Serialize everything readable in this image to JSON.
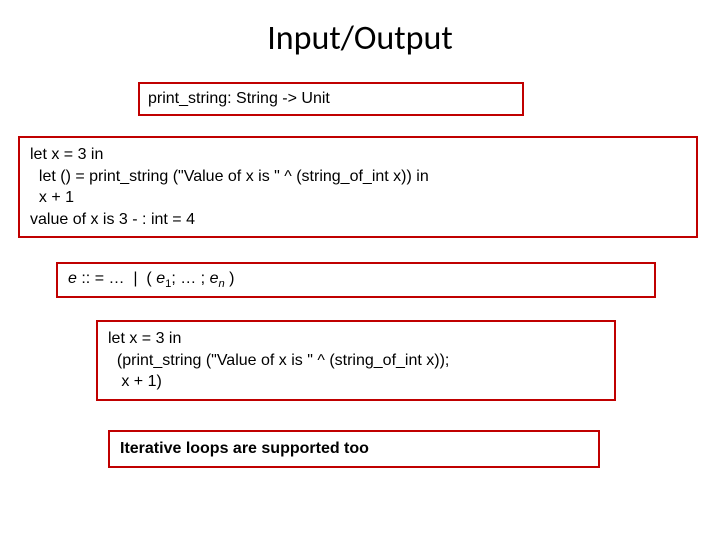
{
  "title": "Input/Output",
  "sig": "print_string: String -> Unit",
  "code1": {
    "l1": "let x = 3 in",
    "l2": "  let () = print_string (\"Value of x is \" ^ (string_of_int x)) in",
    "l3": "  x + 1",
    "l4": "value of x is 3 - : int = 4"
  },
  "grammar": {
    "e": "e",
    "op": " :: = …  |  ( ",
    "e1": "e",
    "sub1": "1",
    "mid": "; … ; ",
    "en": "e",
    "subn": "n",
    "close": " )"
  },
  "code2": {
    "l1": "let x = 3 in",
    "l2": "  (print_string (\"Value of x is \" ^ (string_of_int x));",
    "l3": "   x + 1)"
  },
  "caption": "Iterative loops are supported too"
}
